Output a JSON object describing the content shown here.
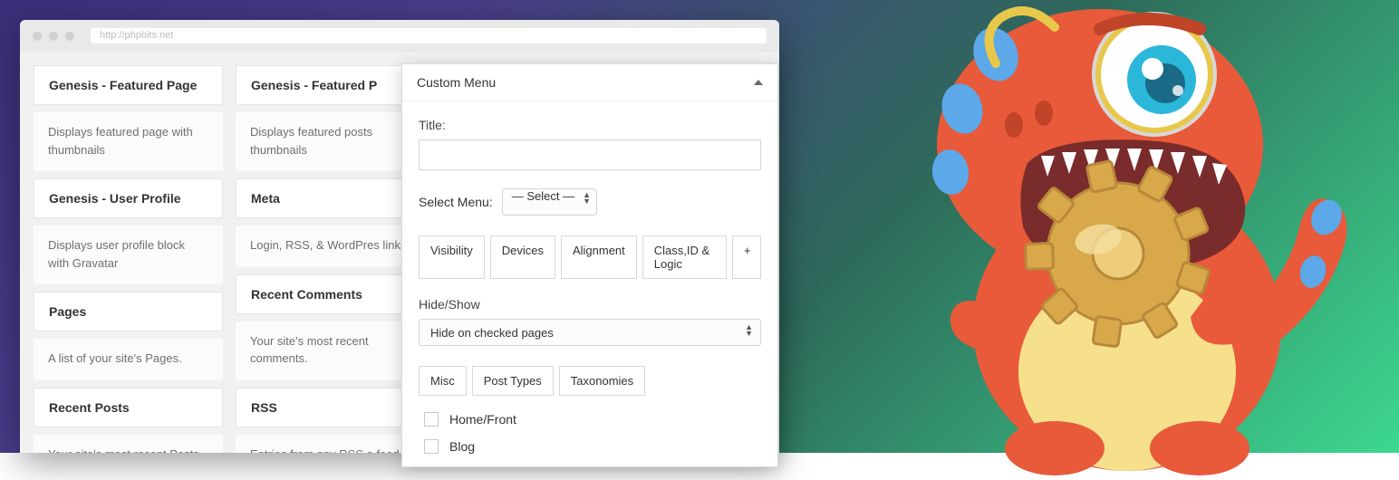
{
  "url_placeholder": "http://phpbits.net",
  "widgets_left": [
    {
      "title": "Genesis - Featured Page",
      "desc": "Displays featured page with thumbnails"
    },
    {
      "title": "Genesis - User Profile",
      "desc": "Displays user profile block with Gravatar"
    },
    {
      "title": "Pages",
      "desc": "A list of your site's Pages."
    },
    {
      "title": "Recent Posts",
      "desc": "Your site's most recent Posts."
    }
  ],
  "widgets_right": [
    {
      "title": "Genesis - Featured P",
      "desc": "Displays featured posts thumbnails"
    },
    {
      "title": "Meta",
      "desc": "Login, RSS, & WordPres links."
    },
    {
      "title": "Recent Comments",
      "desc": "Your site's most recent comments."
    },
    {
      "title": "RSS",
      "desc": "Entries from any RSS o feed."
    }
  ],
  "panel": {
    "title": "Custom Menu",
    "title_label": "Title:",
    "select_menu_label": "Select Menu:",
    "select_menu_value": "— Select —",
    "tabs": [
      "Visibility",
      "Devices",
      "Alignment",
      "Class,ID & Logic"
    ],
    "tab_plus": "+",
    "hideshow_label": "Hide/Show",
    "hideshow_value": "Hide on checked pages",
    "subtabs": [
      "Misc",
      "Post Types",
      "Taxonomies"
    ],
    "checks": [
      "Home/Front",
      "Blog"
    ]
  }
}
